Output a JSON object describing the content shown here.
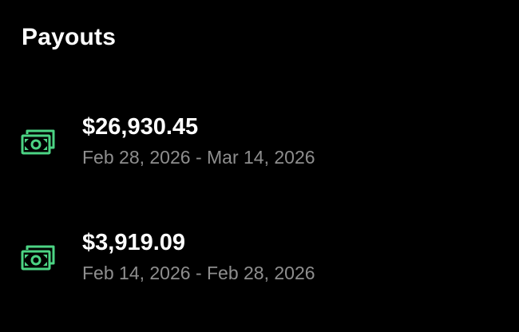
{
  "header": {
    "title": "Payouts"
  },
  "accent_color": "#4cd484",
  "payouts": [
    {
      "icon": "cash-icon",
      "amount": "$26,930.45",
      "date_range": "Feb 28, 2026 - Mar 14, 2026"
    },
    {
      "icon": "cash-icon",
      "amount": "$3,919.09",
      "date_range": "Feb 14, 2026 - Feb 28, 2026"
    }
  ]
}
